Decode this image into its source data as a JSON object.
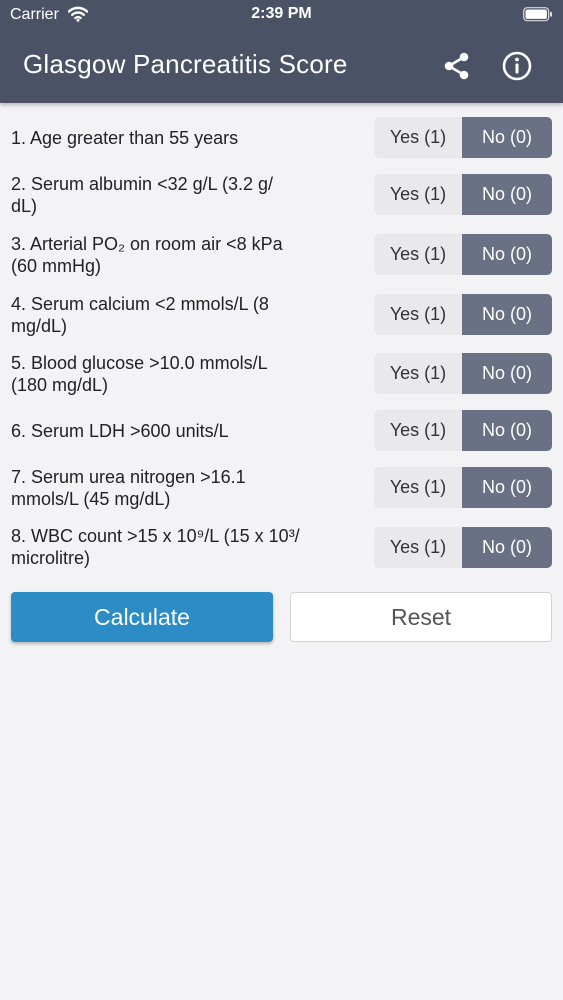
{
  "status": {
    "carrier": "Carrier",
    "time": "2:39 PM"
  },
  "header": {
    "title": "Glasgow Pancreatitis Score"
  },
  "options": {
    "yes": "Yes (1)",
    "no": "No (0)"
  },
  "questions": [
    {
      "line1": "1. Age greater than 55 years",
      "line2": "",
      "selected": "No (0)"
    },
    {
      "line1": "2. Serum albumin <32 g/L (3.2 g/",
      "line2": "dL)",
      "selected": "No (0)"
    },
    {
      "line1": "3. Arterial PO₂ on room air <8 kPa",
      "line2": "(60 mmHg)",
      "selected": "No (0)"
    },
    {
      "line1": "4. Serum calcium <2 mmols/L (8",
      "line2": "mg/dL)",
      "selected": "No (0)"
    },
    {
      "line1": "5. Blood glucose >10.0 mmols/L",
      "line2": "(180 mg/dL)",
      "selected": "No (0)"
    },
    {
      "line1": "6. Serum LDH >600 units/L",
      "line2": "",
      "selected": "No (0)"
    },
    {
      "line1": "7. Serum urea nitrogen >16.1",
      "line2": "mmols/L (45 mg/dL)",
      "selected": "No (0)"
    },
    {
      "line1": "8. WBC count >15 x 10⁹/L (15 x 10³/",
      "line2": "microlitre)",
      "selected": "No (0)"
    }
  ],
  "actions": {
    "calculate": "Calculate",
    "reset": "Reset"
  },
  "colors": {
    "header": "#4b5266",
    "selected_segment": "#6b7184",
    "primary_button": "#2c8dc6",
    "background": "#f3f3f6"
  },
  "icons": {
    "share": "share-icon",
    "info": "info-icon",
    "wifi": "wifi-icon",
    "battery": "battery-icon"
  }
}
